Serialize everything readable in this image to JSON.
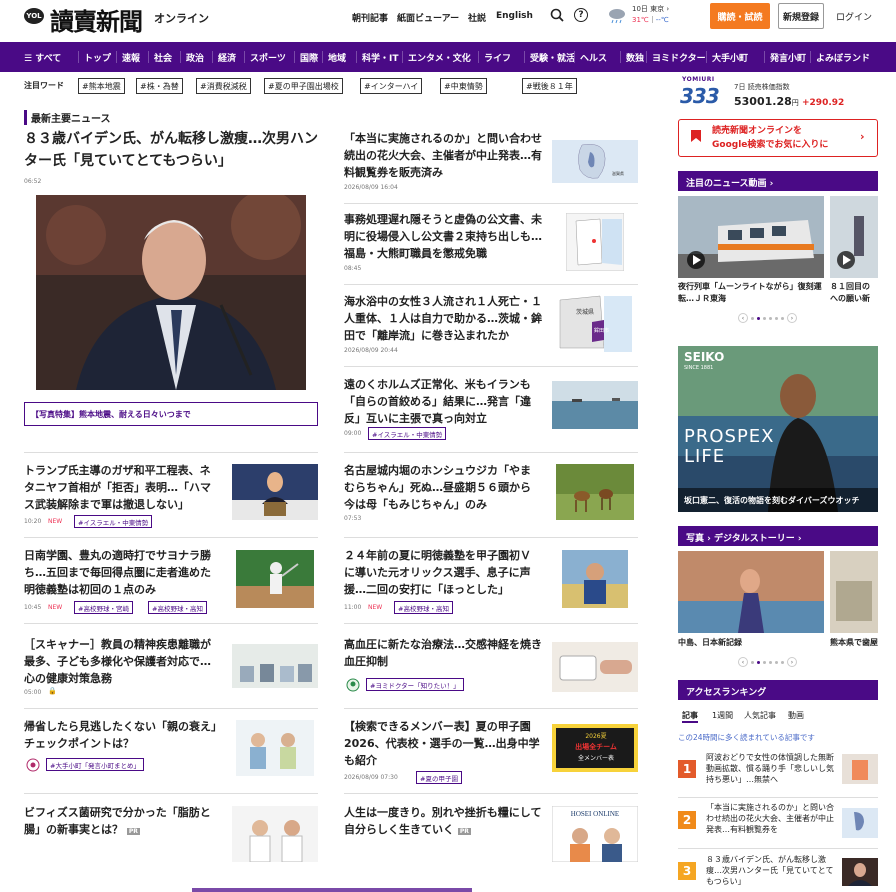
{
  "header": {
    "logo_mark": "YOL",
    "logo_text": "讀賣新聞",
    "logo_sub": "オンライン",
    "links": [
      "朝刊記事",
      "紙面ビューアー",
      "社説",
      "English"
    ],
    "weather_date": "10日 東京 ›",
    "weather_hi": "31℃",
    "weather_lo": "--℃",
    "subscribe": "購読・試読",
    "register": "新規登録",
    "login": "ログイン"
  },
  "nav": [
    "☰ すべて",
    "トップ",
    "速報",
    "社会",
    "政治",
    "経済",
    "スポーツ",
    "国際",
    "地域",
    "科学・IT",
    "エンタメ・文化",
    "ライフ",
    "受験・就活",
    "ヘルス",
    "数独",
    "ヨミドクター",
    "大手小町",
    "発言小町",
    "よみぼランド"
  ],
  "tags": {
    "label": "注目ワード",
    "items": [
      "#熊本地震",
      "#株・為替",
      "#消費税減税",
      "#夏の甲子園出場校",
      "#インターハイ",
      "#中東情勢",
      "#戦後８１年"
    ]
  },
  "main": {
    "section_title": "最新主要ニュース",
    "lead": {
      "title": "８３歳バイデン氏、がん転移し激痩…次男ハンター氏「見ていてとてもつらい」",
      "time": "06:52",
      "photo_banner": "【写真特集】熊本地震、耐える日々いつまで"
    },
    "side": [
      {
        "title": "「本当に実施されるのか」と問い合わせ続出の花火大会、主催者が中止発表…有料観覧券を販売済み",
        "time": "2026/08/09 16:04",
        "map_label": "滋賀県"
      },
      {
        "title": "事務処理遅れ隠そうと虚偽の公文書、未明に役場侵入し公文書２束持ち出しも…福島・大熊町職員を懲戒免職",
        "time": "08:45"
      },
      {
        "title": "海水浴中の女性３人流され１人死亡・１人重体、１人は自力で助かる…茨城・鉾田で「離岸流」に巻き込まれたか",
        "time": "2026/08/09 20:44",
        "map_label1": "茨城県",
        "map_label2": "鉾田市"
      },
      {
        "title": "遠のくホルムズ正常化、米もイランも「自らの首絞める」結果に…発言「違反」互いに主張で真っ向対立",
        "time": "09:00",
        "chip": "#イスラエル・中東情勢"
      }
    ],
    "grid": [
      {
        "title": "トランプ氏主導のガザ和平工程表、ネタニヤフ首相が「拒否」表明…「ハマス武装解除まで軍は撤退しない」",
        "time": "10:20",
        "new": "NEW",
        "chips": [
          "#イスラエル・中東情勢"
        ]
      },
      {
        "title": "名古屋城内堀のホンシュウジカ「やまむらちゃん」死ぬ…昼盛期５６頭から今は母「もみじちゃん」のみ",
        "time": "07:53"
      },
      {
        "title": "日南学園、豊丸の適時打でサヨナラ勝ち…五回まで毎回得点圏に走者進めた明徳義塾は初回の１点のみ",
        "time": "10:45",
        "new": "NEW",
        "chips": [
          "#高校野球・宮崎",
          "#高校野球・高知"
        ]
      },
      {
        "title": "２４年前の夏に明徳義塾を甲子園初Ｖに導いた元オリックス選手、息子に声援…二回の安打に「ほっとした」",
        "time": "11:00",
        "new": "NEW",
        "chips": [
          "#高校野球・高知"
        ]
      },
      {
        "title": "［スキャナー］教員の精神疾患離職が最多、子ども多様化や保護者対応で…心の健康対策急務",
        "time": "05:00",
        "lock": "🔒"
      },
      {
        "title": "高血圧に新たな治療法…交感神経を焼き血圧抑制",
        "chips": [
          "#ヨミドクター「知りたい！」"
        ]
      },
      {
        "title": "帰省したら見逃したくない「親の衰え」チェックポイントは？",
        "chips": [
          "#大手小町「発言小町まとめ」"
        ]
      },
      {
        "title": "【検索できるメンバー表】夏の甲子園2026、代表校・選手の一覧…出身中学も紹介",
        "time": "2026/08/09 07:30",
        "chips": [
          "#夏の甲子園"
        ],
        "thumb_text1": "2026夏",
        "thumb_text2": "出場全チーム",
        "thumb_text3": "全メンバー表"
      },
      {
        "title": "ビフィズス菌研究で分かった「脂肪と腸」の新事実とは？",
        "pr": "PR"
      },
      {
        "title": "人生は一度きり。別れや挫折も糧にして自分らしく生きていく",
        "pr": "PR",
        "thumb_text": "HOSEI ONLINE"
      }
    ]
  },
  "right": {
    "index": {
      "brand": "YOMIURI",
      "num": "333",
      "label": "7日 読売株価指数",
      "value": "53001.28",
      "unit": "円",
      "change": "+290.92"
    },
    "google": {
      "text1": "読売新聞オンラインを",
      "text2": "Google検索でお気に入りに"
    },
    "video_header": "注目のニュース動画 ›",
    "videos": [
      {
        "title": "夜行列車「ムーンライトながら」復刻運転…ＪＲ東海"
      },
      {
        "title": "８１回目の への願い新"
      }
    ],
    "ad": {
      "brand": "SEIKO",
      "since": "SINCE 1881",
      "line1": "PROSPEX",
      "line2": "LIFE",
      "caption": "坂口憲二、復活の物語を刻むダイバーズウオッチ"
    },
    "photo_header": "写真 › デジタルストーリー ›",
    "photos": [
      {
        "title": "中島、日本新記録"
      },
      {
        "title": "熊本県で歯屋"
      }
    ],
    "rank_header": "アクセスランキング",
    "rank_tabs": [
      "記事",
      "1週間",
      "人気記事",
      "動画"
    ],
    "rank_note": "この24時間に多く読まれている記事です",
    "ranks": [
      {
        "n": "1",
        "text": "阿波おどりで女性の体憤調した無断動画拡散、慣る踊り手「悲しいし気持ち悪い」…無禁へ"
      },
      {
        "n": "2",
        "text": "「本当に実施されるのか」と問い合わせ続出の花火大会、主催者が中止発表…有料観覧券を"
      },
      {
        "n": "3",
        "text": "８３歳バイデン氏、がん転移し激痩…次男ハンター氏「見ていてとてもつらい」"
      }
    ],
    "colors": {
      "accent": "#4a0a86",
      "rank1": "#e35a2a",
      "rank2": "#f08a1a",
      "rank3": "#f5a623"
    }
  }
}
